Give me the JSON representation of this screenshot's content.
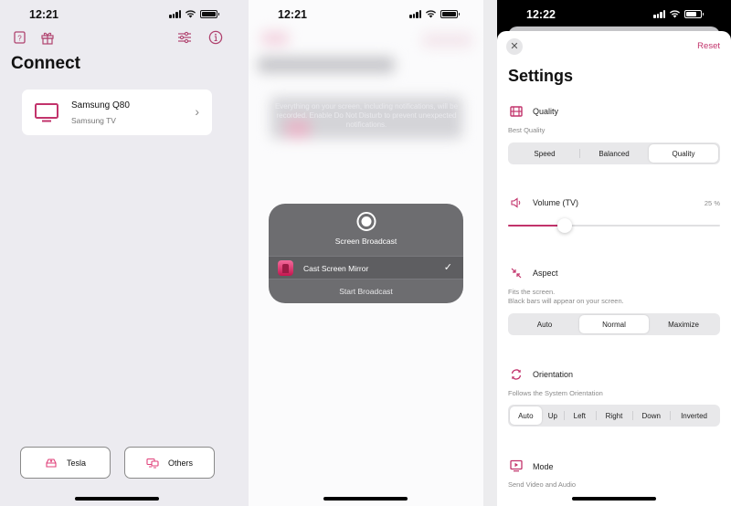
{
  "colors": {
    "accent": "#c2336b",
    "accent_icon": "#b0436f",
    "panel_bg": "#ecebf0",
    "dialog_bg": "#6d6d70"
  },
  "screen1": {
    "status_time": "12:21",
    "top_icons": [
      "help-icon",
      "gift-icon",
      "sliders-icon",
      "info-icon"
    ],
    "title": "Connect",
    "device": {
      "name": "Samsung Q80",
      "type": "Samsung TV",
      "icon": "tv-icon"
    },
    "buttons": [
      {
        "label": "Tesla",
        "icon": "car-icon"
      },
      {
        "label": "Others",
        "icon": "devices-icon"
      }
    ]
  },
  "screen2": {
    "status_time": "12:21",
    "notice": "Everything on your screen, including notifications, will be recorded. Enable Do Not Disturb to prevent unexpected notifications.",
    "dialog": {
      "title": "Screen Broadcast",
      "app_label": "Cast Screen Mirror",
      "checkmark": "✓",
      "start_label": "Start Broadcast"
    }
  },
  "screen3": {
    "status_time": "12:22",
    "close_glyph": "✕",
    "reset_label": "Reset",
    "title": "Settings",
    "quality": {
      "title": "Quality",
      "subtitle": "Best Quality",
      "options": [
        "Speed",
        "Balanced",
        "Quality"
      ],
      "selected": "Quality"
    },
    "volume": {
      "title": "Volume (TV)",
      "value_label": "25 %",
      "value_percent": 25
    },
    "aspect": {
      "title": "Aspect",
      "subtitle_line1": "Fits the screen.",
      "subtitle_line2": "Black bars will appear on your screen.",
      "options": [
        "Auto",
        "Normal",
        "Maximize"
      ],
      "selected": "Normal"
    },
    "orientation": {
      "title": "Orientation",
      "subtitle": "Follows the System Orientation",
      "options": [
        "Auto",
        "Up",
        "Left",
        "Right",
        "Down",
        "Inverted"
      ],
      "selected": "Auto"
    },
    "mode": {
      "title": "Mode",
      "subtitle": "Send Video and Audio"
    }
  }
}
